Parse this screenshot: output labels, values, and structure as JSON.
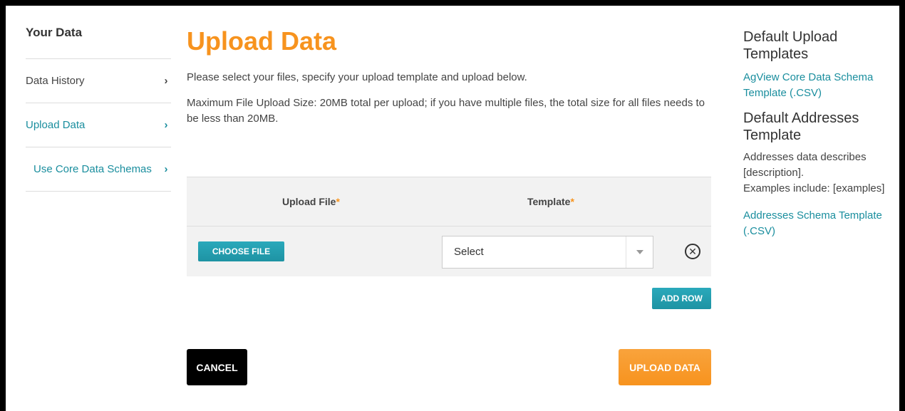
{
  "sidebar": {
    "title": "Your Data",
    "items": [
      {
        "label": "Data History",
        "chevron": "›"
      },
      {
        "label": "Upload Data",
        "chevron": "›"
      },
      {
        "label": "Use Core Data Schemas",
        "chevron": "›"
      }
    ]
  },
  "main": {
    "title": "Upload Data",
    "description": "Please select your files, specify your upload template and upload below.",
    "max_size_note": "Maximum File Upload Size: 20MB total per upload; if you have multiple files, the total size for all files needs to be less than 20MB.",
    "table": {
      "col_file": "Upload File",
      "col_template": "Template",
      "required_mark": "*",
      "choose_file_label": "CHOOSE FILE",
      "template_selected": "Select",
      "remove_glyph": "✕"
    },
    "add_row_label": "ADD ROW",
    "cancel_label": "CANCEL",
    "upload_label": "UPLOAD DATA"
  },
  "right": {
    "upload_templates_heading": "Default Upload Templates",
    "core_schema_link": "AgView Core Data Schema Template (.CSV)",
    "addresses_heading": "Default Addresses Template",
    "addresses_desc": "Addresses data describes [description].",
    "addresses_examples": "Examples include: [examples]",
    "addresses_link": "Addresses Schema Template (.CSV)"
  },
  "colors": {
    "accent_orange": "#f7931e",
    "accent_teal": "#1a8e9e",
    "button_teal": "#2aa9bb"
  }
}
